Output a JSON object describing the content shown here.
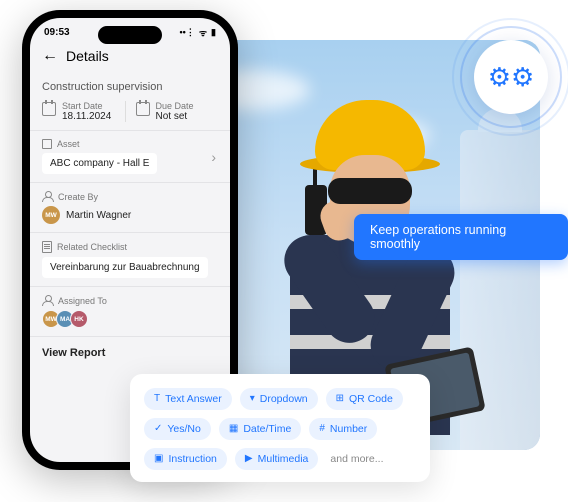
{
  "gear": {
    "name": "gears-icon"
  },
  "callout": {
    "text": "Keep operations running smoothly"
  },
  "phone": {
    "status": {
      "time": "09:53",
      "signal": "•••",
      "wifi": "⋮",
      "battery": "▪"
    },
    "header": {
      "back": "←",
      "title": "Details"
    },
    "section_title": "Construction supervision",
    "start_date": {
      "label": "Start Date",
      "value": "18.11.2024"
    },
    "due_date": {
      "label": "Due Date",
      "value": "Not set"
    },
    "asset": {
      "label": "Asset",
      "value": "ABC company - Hall E"
    },
    "created_by": {
      "label": "Create By",
      "initials": "MW",
      "name": "Martin Wagner"
    },
    "checklist": {
      "label": "Related Checklist",
      "value": "Vereinbarung zur Bauabrechnung"
    },
    "assigned": {
      "label": "Assigned To",
      "avatars": [
        "MW",
        "MA",
        "HK"
      ]
    },
    "view_report": "View Report"
  },
  "chips": {
    "items": [
      {
        "icon": "T",
        "label": "Text Answer"
      },
      {
        "icon": "▾",
        "label": "Dropdown"
      },
      {
        "icon": "⊞",
        "label": "QR Code"
      },
      {
        "icon": "✓",
        "label": "Yes/No"
      },
      {
        "icon": "▦",
        "label": "Date/Time"
      },
      {
        "icon": "#",
        "label": "Number"
      },
      {
        "icon": "▣",
        "label": "Instruction"
      },
      {
        "icon": "▶",
        "label": "Multimedia"
      }
    ],
    "more": "and more..."
  }
}
